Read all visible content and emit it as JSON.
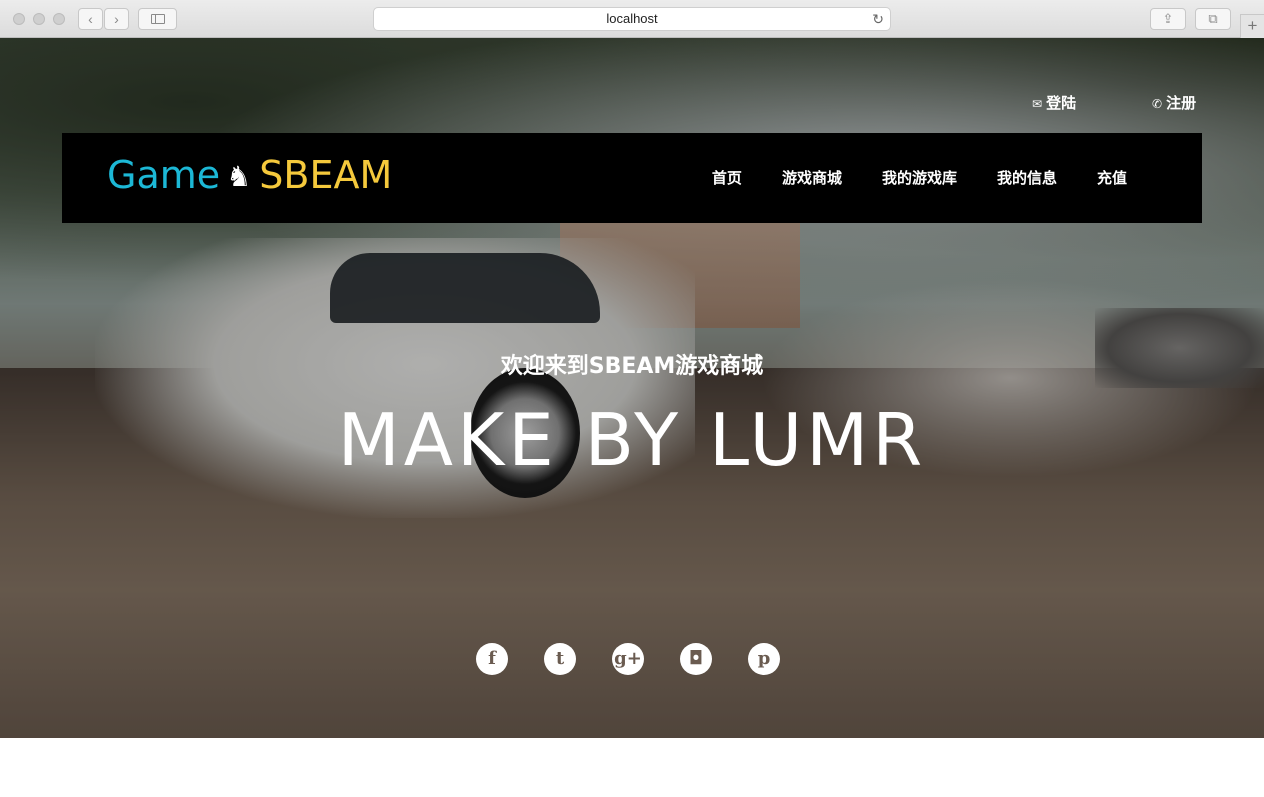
{
  "browser": {
    "address": "localhost",
    "back_glyph": "‹",
    "forward_glyph": "›",
    "reload_glyph": "↻",
    "share_glyph": "⇪",
    "tabs_glyph": "⧉",
    "new_tab_glyph": "+"
  },
  "top_links": {
    "login": {
      "icon": "mail-icon",
      "glyph": "✉",
      "label": "登陆"
    },
    "register": {
      "icon": "phone-icon",
      "glyph": "✆",
      "label": "注册"
    }
  },
  "logo": {
    "part1": "Game",
    "icon": "chess-knight-icon",
    "glyph": "♞",
    "part2": "SBEAM"
  },
  "nav": {
    "items": [
      {
        "label": "首页"
      },
      {
        "label": "游戏商城"
      },
      {
        "label": "我的游戏库"
      },
      {
        "label": "我的信息"
      },
      {
        "label": "充值"
      }
    ]
  },
  "hero": {
    "welcome": "欢迎来到SBEAM游戏商城",
    "headline": "MAKE BY LUMR"
  },
  "socials": [
    {
      "icon": "facebook-icon",
      "glyph": "f"
    },
    {
      "icon": "twitter-icon",
      "glyph": "t"
    },
    {
      "icon": "google-plus-icon",
      "glyph": "g+"
    },
    {
      "icon": "instagram-icon",
      "glyph": "◘"
    },
    {
      "icon": "pinterest-icon",
      "glyph": "p"
    }
  ],
  "colors": {
    "logo_blue": "#1cb8d6",
    "logo_yellow": "#f5c93c",
    "navbar_bg": "#000000"
  }
}
